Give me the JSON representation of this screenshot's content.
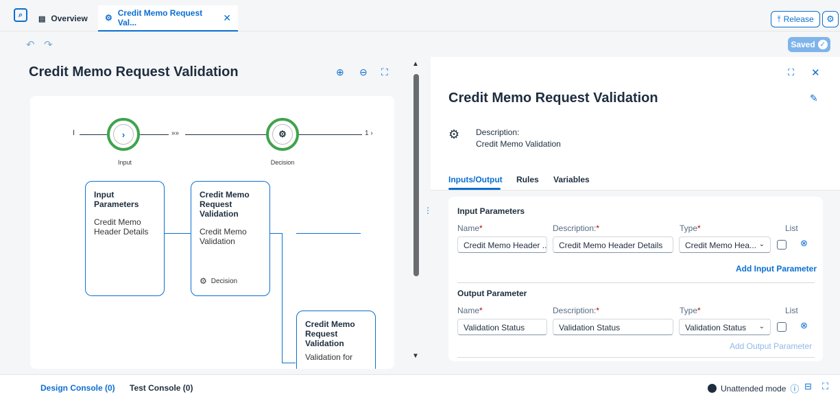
{
  "tabs": {
    "overview": "Overview",
    "active": "Credit Memo Request Val...",
    "close": "✕"
  },
  "header": {
    "release_label": "Release",
    "saved_label": "Saved"
  },
  "left": {
    "title": "Credit Memo Request Validation",
    "flow": {
      "start_marker": "I",
      "chevrons": "»»",
      "end_marker": "1 ›",
      "input_label": "Input",
      "decision_label": "Decision"
    },
    "cards": [
      {
        "title": "Input Parameters",
        "desc": "Credit Memo Header Details"
      },
      {
        "title": "Credit Memo Request Validation",
        "desc": "Credit Memo Validation",
        "footer": "Decision"
      },
      {
        "title": "Credit Memo Request Validation",
        "desc": "Validation for"
      }
    ]
  },
  "right": {
    "title": "Credit Memo Request Validation",
    "description_label": "Description:",
    "description_value": "Credit Memo Validation",
    "tabs": [
      "Inputs/Output",
      "Rules",
      "Variables"
    ],
    "input_section": {
      "title": "Input Parameters",
      "columns": {
        "name": "Name",
        "description": "Description:",
        "type": "Type",
        "list": "List"
      },
      "row": {
        "name": "Credit Memo Header ...",
        "description": "Credit Memo Header Details",
        "type": "Credit Memo Hea..."
      },
      "add_label": "Add Input Parameter"
    },
    "output_section": {
      "title": "Output Parameter",
      "columns": {
        "name": "Name",
        "description": "Description:",
        "type": "Type",
        "list": "List"
      },
      "row": {
        "name": "Validation Status",
        "description": "Validation Status",
        "type": "Validation Status"
      },
      "add_label": "Add Output Parameter"
    },
    "required_mark": "*"
  },
  "bottom": {
    "design_console": "Design Console (0)",
    "test_console": "Test Console (0)",
    "mode": "Unattended mode"
  },
  "colors": {
    "accent": "#0a6ed1",
    "success": "#3fa34d",
    "required": "#aa0808"
  }
}
